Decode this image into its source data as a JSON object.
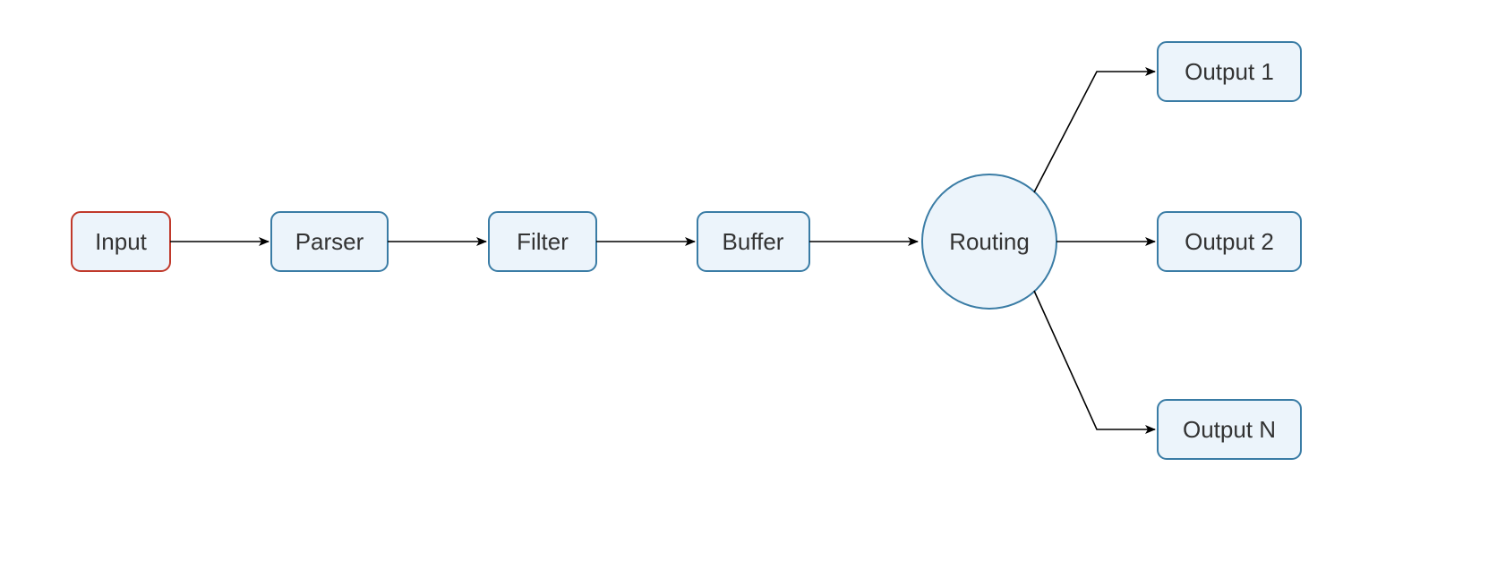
{
  "diagram": {
    "type": "flow",
    "nodes": {
      "input": {
        "label": "Input",
        "shape": "rect",
        "highlight": true
      },
      "parser": {
        "label": "Parser",
        "shape": "rect",
        "highlight": false
      },
      "filter": {
        "label": "Filter",
        "shape": "rect",
        "highlight": false
      },
      "buffer": {
        "label": "Buffer",
        "shape": "rect",
        "highlight": false
      },
      "routing": {
        "label": "Routing",
        "shape": "circle",
        "highlight": false
      },
      "out1": {
        "label": "Output 1",
        "shape": "rect",
        "highlight": false
      },
      "out2": {
        "label": "Output 2",
        "shape": "rect",
        "highlight": false
      },
      "outN": {
        "label": "Output N",
        "shape": "rect",
        "highlight": false
      }
    },
    "edges": [
      [
        "input",
        "parser"
      ],
      [
        "parser",
        "filter"
      ],
      [
        "filter",
        "buffer"
      ],
      [
        "buffer",
        "routing"
      ],
      [
        "routing",
        "out1"
      ],
      [
        "routing",
        "out2"
      ],
      [
        "routing",
        "outN"
      ]
    ],
    "colors": {
      "node_fill": "#ecf4fb",
      "node_stroke": "#3a7ca5",
      "highlight_stroke": "#c0392b",
      "edge": "#000000",
      "text": "#333333"
    }
  }
}
